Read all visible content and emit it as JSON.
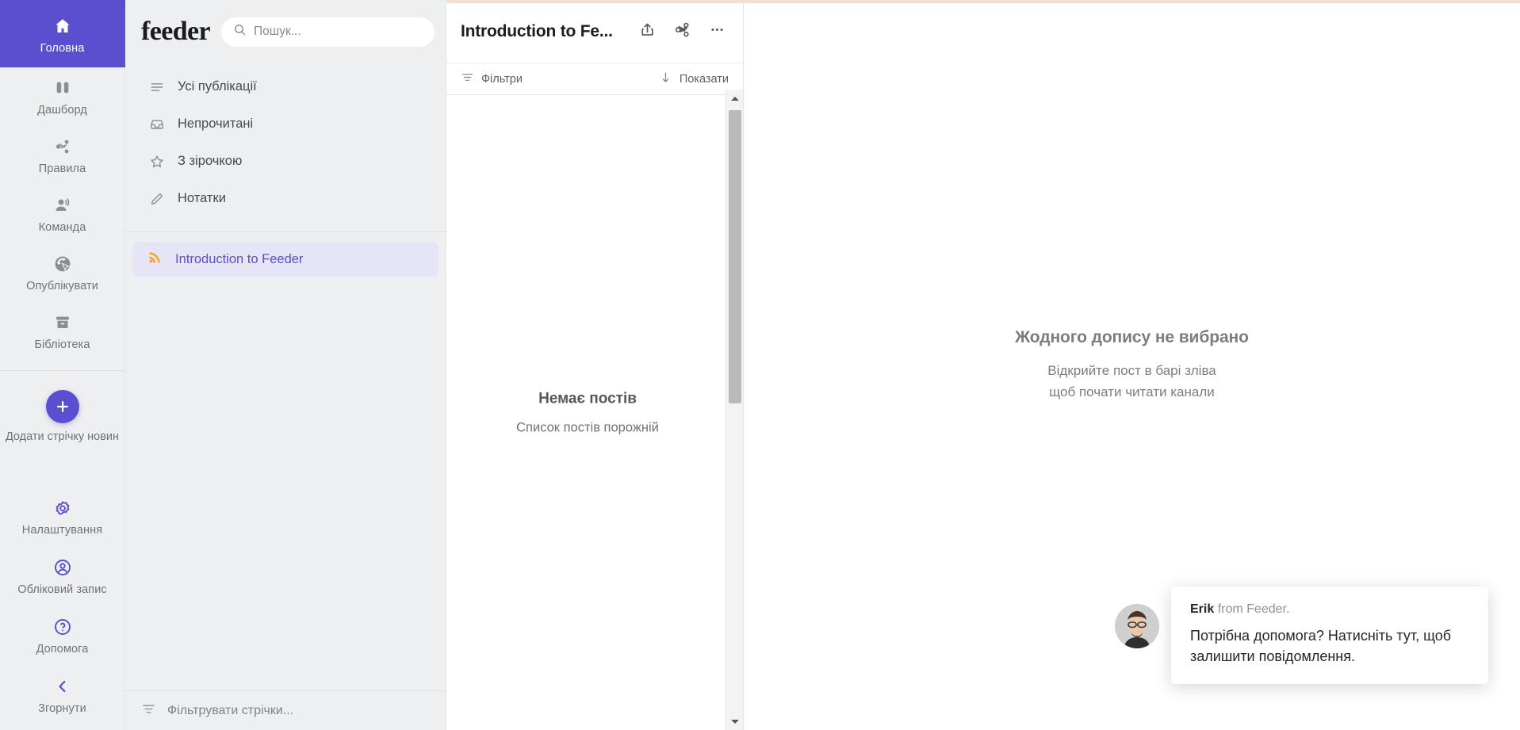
{
  "app": {
    "brand": "feeder"
  },
  "colors": {
    "accent": "#5a4fcf",
    "rail_bg": "#eeeff1",
    "feed_selected_bg": "#e6e4f7",
    "rss_orange": "#f5a623",
    "top_strip": "#f3e2d2"
  },
  "rail": {
    "items": [
      {
        "label": "Головна",
        "icon": "home-icon",
        "active": true
      },
      {
        "label": "Дашборд",
        "icon": "dashboard-icon",
        "active": false
      },
      {
        "label": "Правила",
        "icon": "share-icon",
        "active": false
      },
      {
        "label": "Команда",
        "icon": "team-icon",
        "active": false
      },
      {
        "label": "Опублікувати",
        "icon": "publish-icon",
        "active": false
      },
      {
        "label": "Бібліотека",
        "icon": "library-icon",
        "active": false
      }
    ],
    "add_feed": {
      "label": "Додати стрічку новин",
      "icon": "plus-icon"
    },
    "bottom_items": [
      {
        "label": "Налаштування",
        "icon": "gear-icon"
      },
      {
        "label": "Обліковий запис",
        "icon": "account-icon"
      },
      {
        "label": "Допомога",
        "icon": "help-icon"
      },
      {
        "label": "Згорнути",
        "icon": "chevron-left-icon"
      }
    ]
  },
  "search": {
    "value": "",
    "placeholder": "Пошук...",
    "icon": "search-icon"
  },
  "nav": {
    "items": [
      {
        "label": "Усі публікації",
        "icon": "list-icon"
      },
      {
        "label": "Непрочитані",
        "icon": "inbox-icon"
      },
      {
        "label": "З зірочкою",
        "icon": "star-icon"
      },
      {
        "label": "Нотатки",
        "icon": "pencil-icon"
      }
    ]
  },
  "feeds": {
    "items": [
      {
        "label": "Introduction to Feeder",
        "icon": "rss-icon",
        "selected": true
      }
    ],
    "filter_placeholder": "Фільтрувати стрічки...",
    "filter_icon": "filter-icon"
  },
  "posts": {
    "title": "Introduction to Fe...",
    "actions": [
      {
        "name": "share-export-button",
        "icon": "upload-icon"
      },
      {
        "name": "share-button",
        "icon": "share-icon"
      },
      {
        "name": "more-options-button",
        "icon": "more-dots-icon"
      }
    ],
    "filter_bar": {
      "filters_label": "Фільтри",
      "filters_icon": "filter-icon",
      "sort_label": "Показати",
      "sort_icon": "arrow-down-icon"
    },
    "empty": {
      "title": "Немає постів",
      "subtitle": "Список постів порожній"
    },
    "scrollbar": {
      "up_icon": "caret-up-icon",
      "down_icon": "caret-down-icon"
    }
  },
  "reader": {
    "empty": {
      "title": "Жодного допису не вибрано",
      "line1": "Відкрийте пост в барі зліва",
      "line2": "щоб почати читати канали"
    }
  },
  "chat": {
    "sender": "Erik",
    "from": " from Feeder.",
    "message": "Потрібна допомога? Натисніть тут, щоб залишити повідомлення.",
    "avatar": "agent-avatar"
  }
}
